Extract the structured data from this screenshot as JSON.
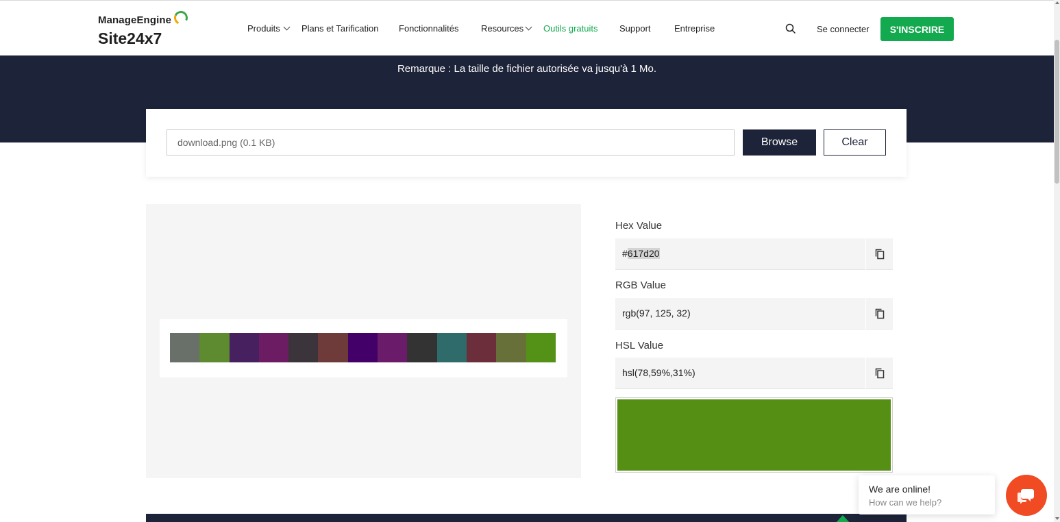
{
  "brand": {
    "line1": "ManageEngine",
    "line2": "Site24x7",
    "accent": "#13a94e",
    "dark": "#1d2338"
  },
  "nav": {
    "items": [
      {
        "label": "Produits",
        "has_dropdown": true
      },
      {
        "label": "Plans et Tarification",
        "has_dropdown": false
      },
      {
        "label": "Fonctionnalités",
        "has_dropdown": false
      },
      {
        "label": "Resources",
        "has_dropdown": true
      },
      {
        "label": "Outils gratuits",
        "has_dropdown": false,
        "active": true
      },
      {
        "label": "Support",
        "has_dropdown": false
      },
      {
        "label": "Entreprise",
        "has_dropdown": false
      }
    ],
    "search_icon": "search-icon",
    "login": "Se connecter",
    "signup": "S'INSCRIRE"
  },
  "hero": {
    "partial_text": "",
    "note": "Remarque : La taille de fichier autorisée va jusqu'à 1 Mo."
  },
  "upload": {
    "file_value": "download.png (0.1 KB)",
    "browse": "Browse",
    "clear": "Clear"
  },
  "palette": [
    "#687069",
    "#5e8a30",
    "#46205f",
    "#6b1c62",
    "#3b343b",
    "#6e3b3a",
    "#430068",
    "#6a1c6b",
    "#333333",
    "#2f6b6b",
    "#6d2e3b",
    "#667038",
    "#549117"
  ],
  "result": {
    "hex_label": "Hex Value",
    "hex_prefix": "#",
    "hex_value": "617d20",
    "rgb_label": "RGB Value",
    "rgb_value": "rgb(97, 125, 32)",
    "hsl_label": "HSL Value",
    "hsl_value": "hsl(78,59%,31%)",
    "preview_color": "#558f13",
    "copy_icon": "copy-icon"
  },
  "chat": {
    "title": "We are online!",
    "subtitle": "How can we help?",
    "icon": "chat-icon"
  }
}
